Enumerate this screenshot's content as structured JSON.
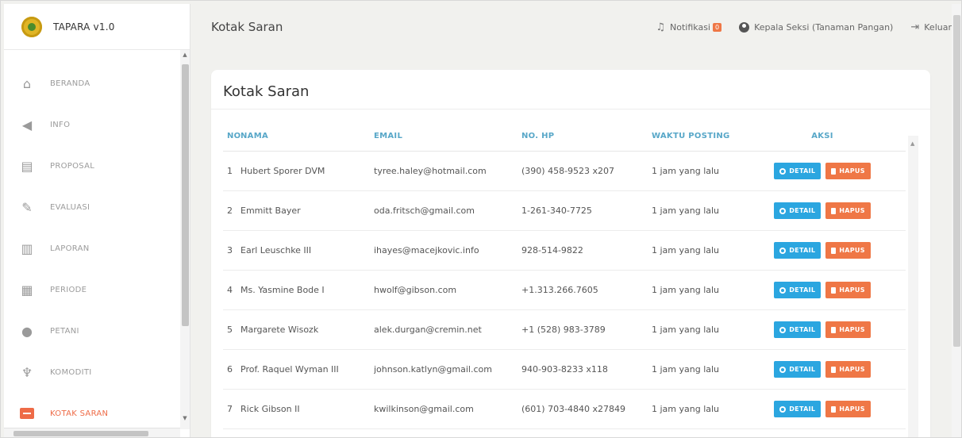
{
  "app": {
    "title": "TAPARA v1.0"
  },
  "sidebar": {
    "items": [
      {
        "label": "BERANDA",
        "icon": "home-icon"
      },
      {
        "label": "INFO",
        "icon": "megaphone-icon"
      },
      {
        "label": "PROPOSAL",
        "icon": "document-icon"
      },
      {
        "label": "EVALUASI",
        "icon": "evaluation-icon"
      },
      {
        "label": "LAPORAN",
        "icon": "bar-chart-icon"
      },
      {
        "label": "PERIODE",
        "icon": "calendar-icon"
      },
      {
        "label": "PETANI",
        "icon": "users-icon"
      },
      {
        "label": "KOMODITI",
        "icon": "plant-icon"
      },
      {
        "label": "KOTAK SARAN",
        "icon": "inbox-icon",
        "active": true
      }
    ]
  },
  "header": {
    "title": "Kotak Saran",
    "notifications": {
      "label": "Notifikasi",
      "count": "0"
    },
    "user": "Kepala Seksi (Tanaman Pangan)",
    "logout": "Keluar"
  },
  "card": {
    "title": "Kotak Saran",
    "columns": [
      "NO",
      "NAMA",
      "EMAIL",
      "NO. HP",
      "WAKTU POSTING",
      "AKSI"
    ],
    "detail_label": "DETAIL",
    "delete_label": "HAPUS",
    "rows": [
      {
        "no": "1",
        "nama": "Hubert Sporer DVM",
        "email": "tyree.haley@hotmail.com",
        "hp": "(390) 458-9523 x207",
        "waktu": "1 jam yang lalu"
      },
      {
        "no": "2",
        "nama": "Emmitt Bayer",
        "email": "oda.fritsch@gmail.com",
        "hp": "1-261-340-7725",
        "waktu": "1 jam yang lalu"
      },
      {
        "no": "3",
        "nama": "Earl Leuschke III",
        "email": "ihayes@macejkovic.info",
        "hp": "928-514-9822",
        "waktu": "1 jam yang lalu"
      },
      {
        "no": "4",
        "nama": "Ms. Yasmine Bode I",
        "email": "hwolf@gibson.com",
        "hp": "+1.313.266.7605",
        "waktu": "1 jam yang lalu"
      },
      {
        "no": "5",
        "nama": "Margarete Wisozk",
        "email": "alek.durgan@cremin.net",
        "hp": "+1 (528) 983-3789",
        "waktu": "1 jam yang lalu"
      },
      {
        "no": "6",
        "nama": "Prof. Raquel Wyman III",
        "email": "johnson.katlyn@gmail.com",
        "hp": "940-903-8233 x118",
        "waktu": "1 jam yang lalu"
      },
      {
        "no": "7",
        "nama": "Rick Gibson II",
        "email": "kwilkinson@gmail.com",
        "hp": "(601) 703-4840 x27849",
        "waktu": "1 jam yang lalu"
      }
    ]
  },
  "colors": {
    "accent": "#ef7746",
    "header_text": "#58a7c8",
    "detail": "#2ba6e0"
  }
}
